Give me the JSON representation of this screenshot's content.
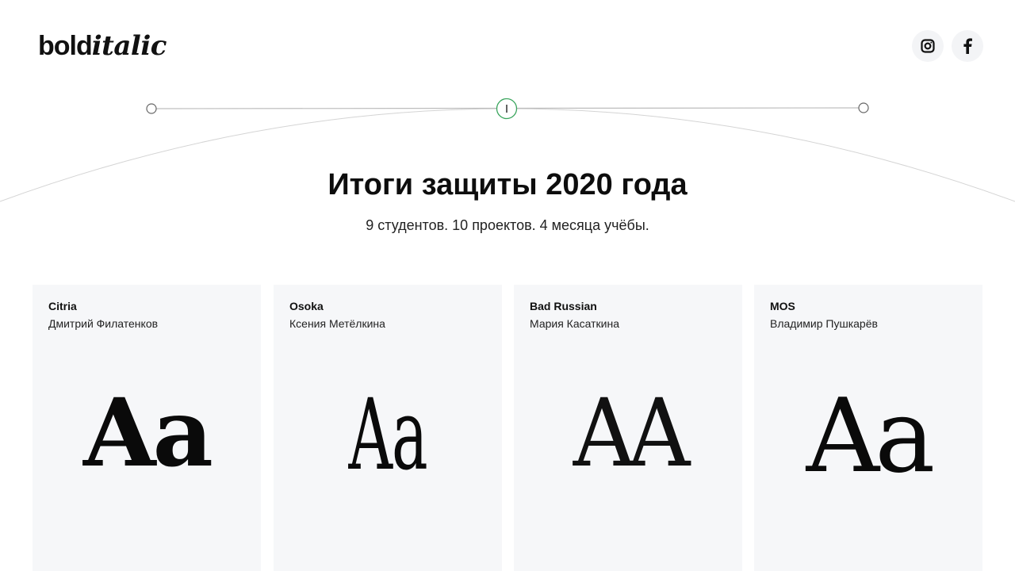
{
  "brand": {
    "bold": "bold",
    "italic": "italic"
  },
  "social": {
    "instagram_icon": "instagram-icon",
    "facebook_icon": "facebook-icon"
  },
  "timeline": {
    "points": 3,
    "active_index": 1,
    "accent_color": "#3aa55d"
  },
  "hero": {
    "title": "Итоги защиты 2020 года",
    "subtitle": "9 студентов. 10 проектов. 4 месяца учёбы."
  },
  "projects": [
    {
      "name": "Citria",
      "author": "Дмитрий Филатенков",
      "sample": "Aa"
    },
    {
      "name": "Osoka",
      "author": "Ксения Метёлкина",
      "sample": "Aa"
    },
    {
      "name": "Bad Russian",
      "author": "Мария Касаткина",
      "sample": "AA"
    },
    {
      "name": "MOS",
      "author": "Владимир Пушкарёв",
      "sample": "Aa"
    }
  ],
  "colors": {
    "card_bg": "#f6f7f9",
    "social_bg": "#f3f4f6",
    "text": "#111111"
  }
}
